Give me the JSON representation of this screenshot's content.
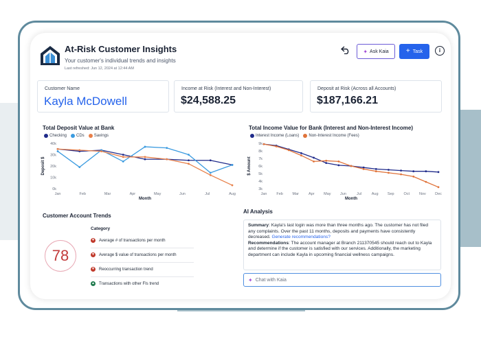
{
  "header": {
    "title": "At-Risk Customer Insights",
    "subtitle": "Your customer's individual trends and insights",
    "last_refreshed": "Last refreshed: Jun 12, 2024 at 12:44 AM",
    "ask_button": "Ask Kaia",
    "task_button": "Task",
    "info_label": "i"
  },
  "metrics": {
    "customer_name_label": "Customer Name",
    "customer_name": "Kayla McDowell",
    "income_label": "Income at Risk (Interest and Non-Interest)",
    "income_value": "$24,588.25",
    "deposit_label": "Deposit at Risk (Across all Accounts)",
    "deposit_value": "$187,166.21"
  },
  "colors": {
    "checking": "#1f2a8a",
    "cds": "#3b9be0",
    "savings": "#e8804a",
    "interest": "#1f2a8a",
    "non_interest": "#e0733a"
  },
  "chart_data": [
    {
      "type": "line",
      "title": "Total Deposit Value at Bank",
      "xlabel": "Month",
      "ylabel": "Deposit $",
      "categories": [
        "Jan",
        "Feb",
        "Mar",
        "Apr",
        "May",
        "Jun",
        "Jul",
        "Aug"
      ],
      "y_ticks": [
        "0k",
        "10k",
        "20k",
        "30k",
        "40k"
      ],
      "ylim": [
        0,
        40
      ],
      "legend": "top-left",
      "series": [
        {
          "name": "Checking",
          "values": [
            35,
            33,
            34,
            30,
            26,
            26,
            25,
            25,
            21
          ]
        },
        {
          "name": "CDs",
          "values": [
            33,
            19,
            34,
            24,
            37,
            36,
            30,
            14,
            21
          ]
        },
        {
          "name": "Savings",
          "values": [
            35,
            34,
            33,
            28,
            28,
            26,
            22,
            12,
            3
          ]
        }
      ]
    },
    {
      "type": "line",
      "title": "Total Income Value for Bank (Interest and Non-Interest Income)",
      "xlabel": "Month",
      "ylabel": "$ Amount",
      "categories": [
        "Jan",
        "Feb",
        "Mar",
        "Apr",
        "May",
        "Jun",
        "Jul",
        "Aug",
        "Sep",
        "Oct",
        "Nov",
        "Dec"
      ],
      "y_ticks": [
        "3k",
        "4k",
        "5k",
        "6k",
        "7k",
        "8k",
        "9k"
      ],
      "ylim": [
        3,
        9
      ],
      "legend": "top-left",
      "series": [
        {
          "name": "Interest Income (Loans)",
          "values": [
            8.9,
            8.7,
            8.2,
            7.7,
            7.1,
            6.4,
            6.1,
            6.0,
            5.8,
            5.6,
            5.5,
            5.4,
            5.3,
            5.3,
            5.2
          ]
        },
        {
          "name": "Non-Interest Income (Fees)",
          "values": [
            8.9,
            8.6,
            8.1,
            7.4,
            6.6,
            6.7,
            6.6,
            6.0,
            5.6,
            5.3,
            5.1,
            4.9,
            4.6,
            3.9,
            3.2
          ]
        }
      ]
    }
  ],
  "trends": {
    "title": "Customer Account Trends",
    "score": "78",
    "category_header": "Category",
    "rows": [
      {
        "label": "Average # of transactions per month",
        "direction": "down"
      },
      {
        "label": "Average $ value of transactions per month",
        "direction": "down"
      },
      {
        "label": "Reoccurring transaction trend",
        "direction": "down"
      },
      {
        "label": "Transactions with other FIs trend",
        "direction": "up"
      }
    ]
  },
  "ai": {
    "title": "AI Analysis",
    "summary_label": "Summary",
    "summary_text": ": Kayla's last login was more than three months ago. The customer has not filed any complaints. Over the past 11 months, deposits and payments have consistently decreased. ",
    "summary_link": "Generate recommendations?",
    "rec_label": "Recommendations",
    "rec_text": ": The account manager at Branch 211370545 should reach out to Kayla and determine if the customer is satisfied with our services. Additionally, the marketing department can include Kayla in upcoming financial wellness campaigns.",
    "chat_placeholder": "Chat with Kaia"
  }
}
